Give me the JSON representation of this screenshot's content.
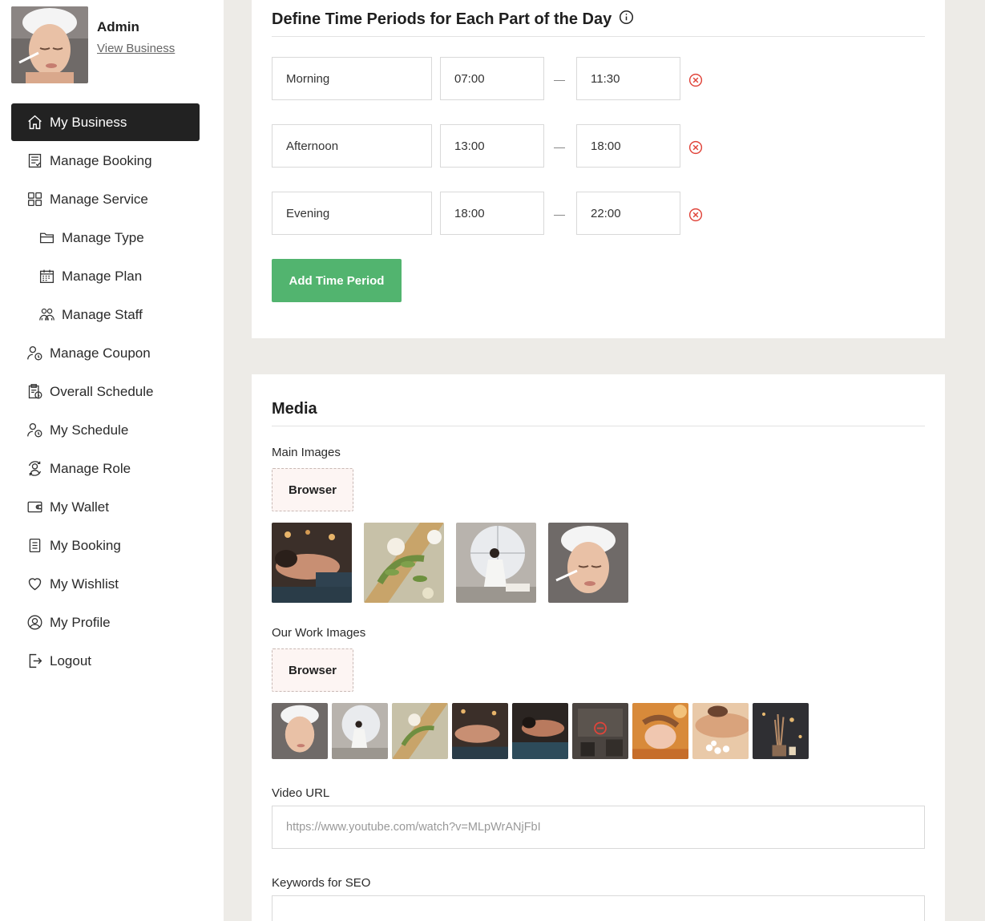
{
  "profile": {
    "name": "Admin",
    "link": "View Business"
  },
  "nav": [
    {
      "label": "My Business",
      "icon": "home-icon",
      "active": true
    },
    {
      "label": "Manage Booking",
      "icon": "booking-list-icon"
    },
    {
      "label": "Manage Service",
      "icon": "grid-icon"
    },
    {
      "label": "Manage Type",
      "icon": "folder-icon",
      "sub": true
    },
    {
      "label": "Manage Plan",
      "icon": "calendar-icon",
      "sub": true
    },
    {
      "label": "Manage Staff",
      "icon": "staff-icon",
      "sub": true
    },
    {
      "label": "Manage Coupon",
      "icon": "user-clock-icon"
    },
    {
      "label": "Overall Schedule",
      "icon": "clipboard-clock-icon"
    },
    {
      "label": "My Schedule",
      "icon": "user-clock-icon"
    },
    {
      "label": "Manage Role",
      "icon": "role-icon"
    },
    {
      "label": "My Wallet",
      "icon": "wallet-icon"
    },
    {
      "label": "My Booking",
      "icon": "document-icon"
    },
    {
      "label": "My Wishlist",
      "icon": "heart-icon"
    },
    {
      "label": "My Profile",
      "icon": "user-circle-icon"
    },
    {
      "label": "Logout",
      "icon": "logout-icon"
    }
  ],
  "periods": {
    "title": "Define Time Periods for Each Part of the Day",
    "rows": [
      {
        "name": "Morning",
        "start": "07:00",
        "end": "11:30"
      },
      {
        "name": "Afternoon",
        "start": "13:00",
        "end": "18:00"
      },
      {
        "name": "Evening",
        "start": "18:00",
        "end": "22:00"
      }
    ],
    "add_label": "Add Time Period"
  },
  "media": {
    "title": "Media",
    "main_images_label": "Main Images",
    "work_images_label": "Our Work Images",
    "browse_label": "Browser",
    "video_label": "Video URL",
    "video_value": "https://www.youtube.com/watch?v=MLpWrANjFbI",
    "seo_label": "Keywords for SEO"
  },
  "colors": {
    "accent_green": "#52b46f",
    "remove_red": "#e0443a",
    "active_nav": "#222222"
  }
}
